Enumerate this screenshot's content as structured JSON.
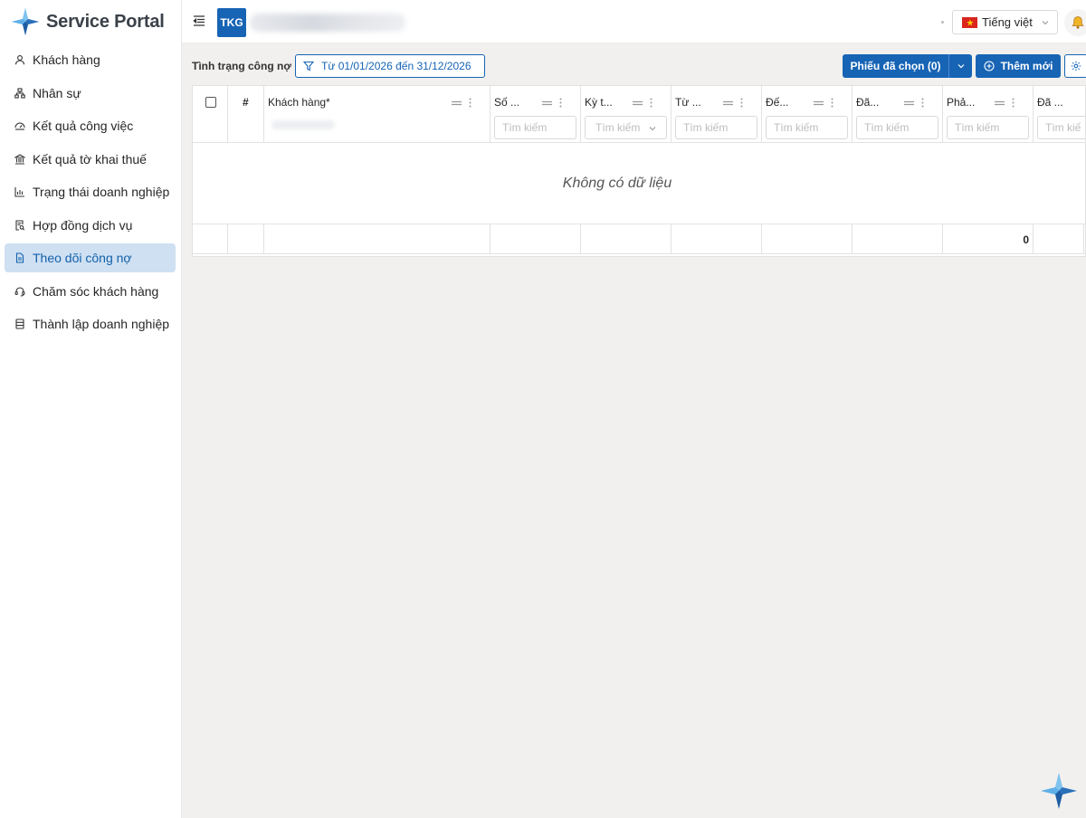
{
  "app": {
    "title": "Service Portal"
  },
  "sidebar": {
    "items": [
      {
        "label": "Khách hàng",
        "icon": "user-icon",
        "active": false
      },
      {
        "label": "Nhân sự",
        "icon": "org-chart-icon",
        "active": false
      },
      {
        "label": "Kết quả công việc",
        "icon": "dashboard-icon",
        "active": false
      },
      {
        "label": "Kết quả tờ khai thuế",
        "icon": "bank-icon",
        "active": false
      },
      {
        "label": "Trạng thái doanh nghiệp",
        "icon": "bar-chart-icon",
        "active": false
      },
      {
        "label": "Hợp đồng dịch vụ",
        "icon": "audit-icon",
        "active": false
      },
      {
        "label": "Theo dõi công nợ",
        "icon": "file-icon",
        "active": true
      },
      {
        "label": "Chăm sóc khách hàng",
        "icon": "customer-service-icon",
        "active": false
      },
      {
        "label": "Thành lập doanh nghiệp",
        "icon": "database-icon",
        "active": false
      }
    ]
  },
  "header": {
    "org_code": "TKG",
    "language": "Tiếng việt"
  },
  "toolbar": {
    "status_label": "Tình trạng công nợ",
    "date_filter": "Từ 01/01/2026 đến 31/12/2026",
    "selected_label": "Phiếu đã chọn (0)",
    "add_label": "Thêm mới"
  },
  "table": {
    "index_header": "#",
    "columns": [
      {
        "title": "Khách hàng*",
        "search": ""
      },
      {
        "title": "Số ...",
        "search": "Tìm kiếm"
      },
      {
        "title": "Kỳ t...",
        "search": "Tìm kiếm"
      },
      {
        "title": "Từ ...",
        "search": "Tìm kiếm"
      },
      {
        "title": "Đế...",
        "search": "Tìm kiếm"
      },
      {
        "title": "Đã...",
        "search": "Tìm kiếm"
      },
      {
        "title": "Phả...",
        "search": "Tìm kiếm"
      },
      {
        "title": "Đã ...",
        "search": "Tìm kiế"
      }
    ],
    "empty_text": "Không có dữ liệu",
    "footer_total": "0"
  },
  "colors": {
    "primary": "#1764b5",
    "active_bg": "#cfe0f3",
    "page_bg": "#f1f0ee"
  }
}
